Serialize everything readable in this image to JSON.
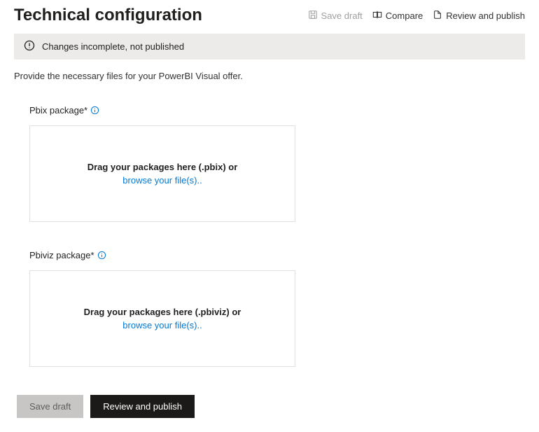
{
  "header": {
    "title": "Technical configuration",
    "actions": {
      "save_draft": "Save draft",
      "compare": "Compare",
      "review_publish": "Review and publish"
    }
  },
  "status": {
    "message": "Changes incomplete, not published"
  },
  "description": "Provide the necessary files for your PowerBI Visual offer.",
  "pbix": {
    "label": "Pbix package*",
    "drag_text": "Drag your packages here (.pbix) or",
    "browse_text": "browse your file(s).."
  },
  "pbiviz": {
    "label": "Pbiviz package*",
    "drag_text": "Drag your packages here (.pbiviz) or",
    "browse_text": "browse your file(s).."
  },
  "footer": {
    "save_draft": "Save draft",
    "review_publish": "Review and publish"
  }
}
